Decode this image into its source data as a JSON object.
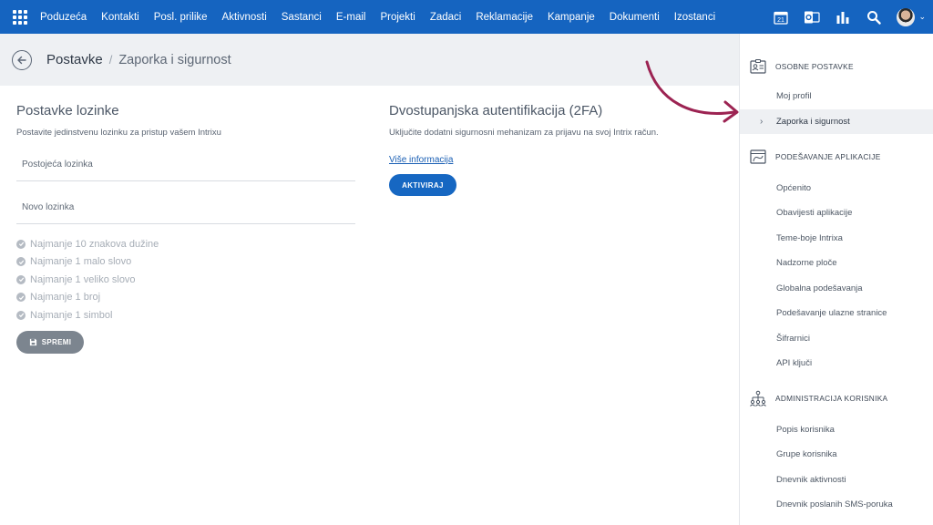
{
  "nav": {
    "items": [
      "Poduzeća",
      "Kontakti",
      "Posl. prilike",
      "Aktivnosti",
      "Sastanci",
      "E-mail",
      "Projekti",
      "Zadaci",
      "Reklamacije",
      "Kampanje",
      "Dokumenti",
      "Izostanci"
    ],
    "calendar_day": "21",
    "icons": [
      "apps-grid-icon",
      "calendar-icon",
      "outlook-icon",
      "bar-chart-icon",
      "search-icon",
      "avatar",
      "chevron-down-icon"
    ]
  },
  "header": {
    "breadcrumb_root": "Postavke",
    "breadcrumb_sep": "/",
    "breadcrumb_current": "Zaporka i sigurnost"
  },
  "password": {
    "title": "Postavke lozinke",
    "subtitle": "Postavite jedinstvenu lozinku za pristup vašem Intrixu",
    "current_placeholder": "Postojeća lozinka",
    "new_placeholder": "Novo lozinka",
    "rules": [
      "Najmanje 10 znakova dužine",
      "Najmanje 1 malo slovo",
      "Najmanje 1 veliko slovo",
      "Najmanje 1 broj",
      "Najmanje 1 simbol"
    ],
    "save_label": "SPREMI"
  },
  "twofa": {
    "title": "Dvostupanjska autentifikacija (2FA)",
    "subtitle": "Uključite dodatni sigurnosni mehanizam za prijavu na svoj Intrix račun.",
    "more_link": "Više informacija",
    "activate_label": "AKTIVIRAJ"
  },
  "sidebar": {
    "sections": [
      {
        "title": "OSOBNE POSTAVKE",
        "icon": "id-card-icon",
        "items": [
          "Moj profil",
          "Zaporka i sigurnost"
        ]
      },
      {
        "title": "PODEŠAVANJE APLIKACIJE",
        "icon": "app-window-icon",
        "items": [
          "Općenito",
          "Obavijesti aplikacije",
          "Teme-boje Intrixa",
          "Nadzorne ploče",
          "Globalna podešavanja",
          "Podešavanje ulazne stranice",
          "Šifrarnici",
          "API ključi"
        ]
      },
      {
        "title": "ADMINISTRACIJA KORISNIKA",
        "icon": "org-chart-icon",
        "items": [
          "Popis korisnika",
          "Grupe korisnika",
          "Dnevnik aktivnosti",
          "Dnevnik poslanih SMS-poruka"
        ]
      }
    ],
    "active_item": "Zaporka i sigurnost"
  },
  "colors": {
    "topbar": "#1564c0",
    "accent_button": "#1667c2",
    "annotation_arrow": "#9c2352",
    "save_button": "#7c858f"
  }
}
